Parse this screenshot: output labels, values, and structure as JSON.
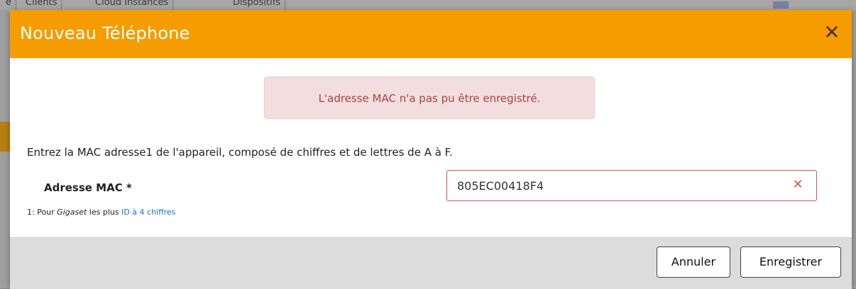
{
  "background": {
    "tabs": [
      "e",
      "Clients",
      "Cloud Instances",
      "Dispositifs"
    ]
  },
  "modal": {
    "title": "Nouveau Téléphone",
    "close_icon": "close-icon",
    "alert_text": "L'adresse MAC n'a pas pu être enregistré.",
    "instructions": "Entrez la MAC adresse1 de l'appareil, composé de chiffres et de lettres de A à F.",
    "field": {
      "label": "Adresse MAC *",
      "value": "805EC00418F4",
      "clear_icon": "clear-x-icon"
    },
    "footnote": {
      "prefix": "1: Pour ",
      "brand": "Gigaset",
      "middle": " les plus ",
      "link": "ID à 4 chiffres"
    },
    "buttons": {
      "cancel": "Annuler",
      "save": "Enregistrer"
    }
  },
  "colors": {
    "header": "#f59c00",
    "alert_bg": "#f2dede",
    "alert_text": "#a94442",
    "error_border": "#d9534f",
    "link": "#1a73c8"
  }
}
